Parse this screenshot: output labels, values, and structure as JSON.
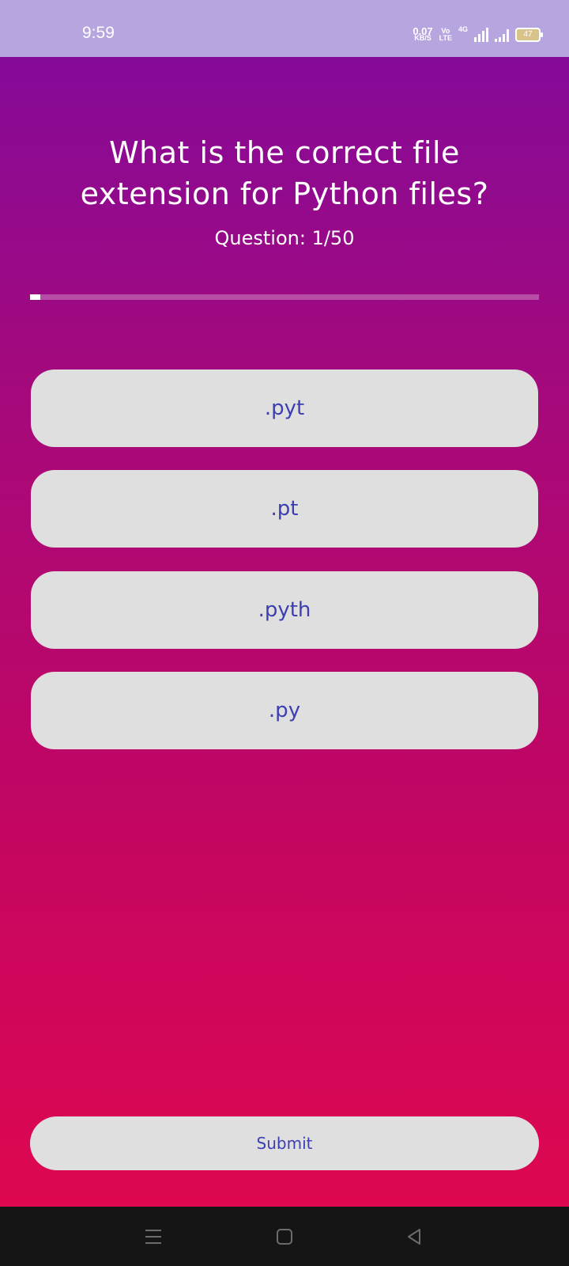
{
  "status_bar": {
    "time": "9:59",
    "net_speed_value": "0.07",
    "net_speed_unit": "KB/S",
    "volte_top": "Vo",
    "volte_bottom": "LTE",
    "network_type": "4G",
    "battery_level": "47",
    "icons": [
      "volte-icon",
      "signal-4g-icon",
      "signal-icon",
      "battery-icon"
    ]
  },
  "quiz": {
    "question": "What is the correct file extension for Python files?",
    "counter": "Question: 1/50",
    "progress_fraction": 0.02,
    "options": [
      ".pyt",
      ".pt",
      ".pyth",
      ".py"
    ],
    "submit_label": "Submit"
  },
  "nav_bar": {
    "icons": [
      "menu-icon",
      "home-icon",
      "back-icon"
    ]
  },
  "colors": {
    "status_bar_bg": "#b7a5e0",
    "gradient_top": "#850a98",
    "gradient_bottom": "#de0750",
    "option_bg": "#e0dfe0",
    "option_text": "#3b3fb0",
    "nav_bar_bg": "#151515"
  }
}
